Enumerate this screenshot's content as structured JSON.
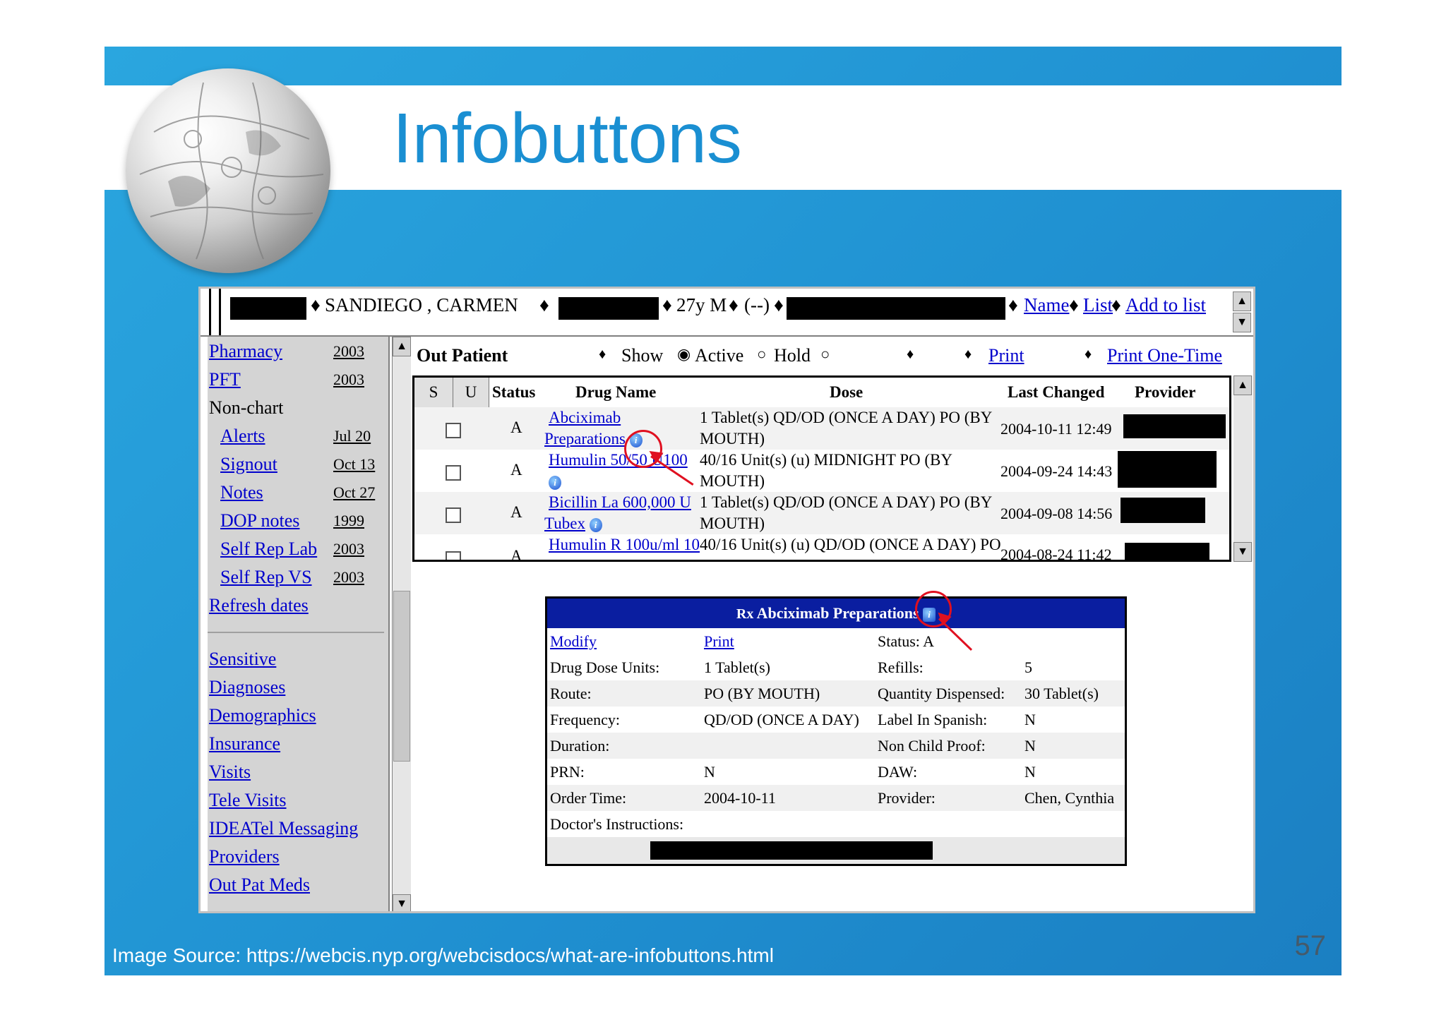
{
  "slide": {
    "title": "Infobuttons",
    "source_label": "Image Source:",
    "source_url": "https://webcis.nyp.org/webcisdocs/what-are-infobuttons.html",
    "page_number": "57"
  },
  "patient_bar": {
    "name": "SANDIEGO , CARMEN",
    "age_sex": "27y M",
    "code": "(--)",
    "links": [
      "Name",
      "List",
      "Add to list"
    ]
  },
  "nav": {
    "items": [
      {
        "label": "Pharmacy",
        "date": "2003"
      },
      {
        "label": "PFT",
        "date": "2003"
      },
      {
        "label": "Non-chart",
        "date": ""
      },
      {
        "label": "Alerts",
        "date": "Jul 20"
      },
      {
        "label": "Signout",
        "date": "Oct 13"
      },
      {
        "label": "Notes",
        "date": "Oct 27"
      },
      {
        "label": "DOP notes",
        "date": "1999"
      },
      {
        "label": "Self Rep Lab",
        "date": "2003"
      },
      {
        "label": "Self Rep VS",
        "date": "2003"
      },
      {
        "label": "Refresh dates",
        "date": ""
      }
    ],
    "items2": [
      "Sensitive",
      "Diagnoses",
      "Demographics",
      "Insurance",
      "Visits",
      "Tele Visits",
      "IDEATel Messaging",
      "Providers",
      "Out Pat Meds"
    ]
  },
  "toolbar": {
    "title": "Out Patient",
    "show": "Show",
    "active": "Active",
    "hold": "Hold",
    "print": "Print",
    "print_one_time": "Print One-Time"
  },
  "table": {
    "headers": [
      "S",
      "U",
      "Status",
      "Drug Name",
      "Dose",
      "Last Changed",
      "Provider"
    ],
    "rows": [
      {
        "status": "A",
        "drug1": "Abciximab",
        "drug2": "Preparations",
        "dose1": "1 Tablet(s) QD/OD (ONCE A DAY) PO (BY",
        "dose2": "MOUTH)",
        "changed": "2004-10-11 12:49"
      },
      {
        "status": "A",
        "drug1": "Humulin 50/50 U100",
        "drug2": "",
        "dose1": "40/16 Unit(s) (u) MIDNIGHT PO (BY",
        "dose2": "MOUTH)",
        "changed": "2004-09-24 14:43"
      },
      {
        "status": "A",
        "drug1": "Bicillin La 600,000 U",
        "drug2": "Tubex",
        "dose1": "1 Tablet(s) QD/OD (ONCE A DAY) PO (BY",
        "dose2": "MOUTH)",
        "changed": "2004-09-08 14:56"
      },
      {
        "status": "A",
        "drug1": "Humulin R 100u/ml 10",
        "drug2": "",
        "dose1": "40/16 Unit(s) (u) QD/OD (ONCE A DAY) PO",
        "dose2": "",
        "changed": "2004-08-24 11:42"
      }
    ]
  },
  "popup": {
    "title_rx": "Rx",
    "title": "Abciximab Preparations",
    "modify": "Modify",
    "print": "Print",
    "status": "Status: A",
    "fields": [
      {
        "k1": "Drug Dose Units:",
        "v1": "1 Tablet(s)",
        "k2": "Refills:",
        "v2": "5"
      },
      {
        "k1": "Route:",
        "v1": "PO (BY MOUTH)",
        "k2": "Quantity Dispensed:",
        "v2": "30 Tablet(s)"
      },
      {
        "k1": "Frequency:",
        "v1": "QD/OD (ONCE A DAY)",
        "k2": "Label In Spanish:",
        "v2": "N"
      },
      {
        "k1": "Duration:",
        "v1": "",
        "k2": "Non Child Proof:",
        "v2": "N"
      },
      {
        "k1": "PRN:",
        "v1": "N",
        "k2": "DAW:",
        "v2": "N"
      },
      {
        "k1": "Order Time:",
        "v1": "2004-10-11",
        "k2": "Provider:",
        "v2": "Chen, Cynthia"
      }
    ],
    "instructions": "Doctor's Instructions:"
  },
  "colors": {
    "slide_blue": "#1f8fd0",
    "title_blue": "#1a8fd2",
    "popup_header": "#0a1ea0",
    "highlight_red": "#e01020"
  },
  "icons": [
    "globe-logo",
    "info-icon",
    "bullet-icon",
    "scroll-up-icon",
    "scroll-down-icon",
    "checkbox-icon",
    "radio-icon"
  ]
}
